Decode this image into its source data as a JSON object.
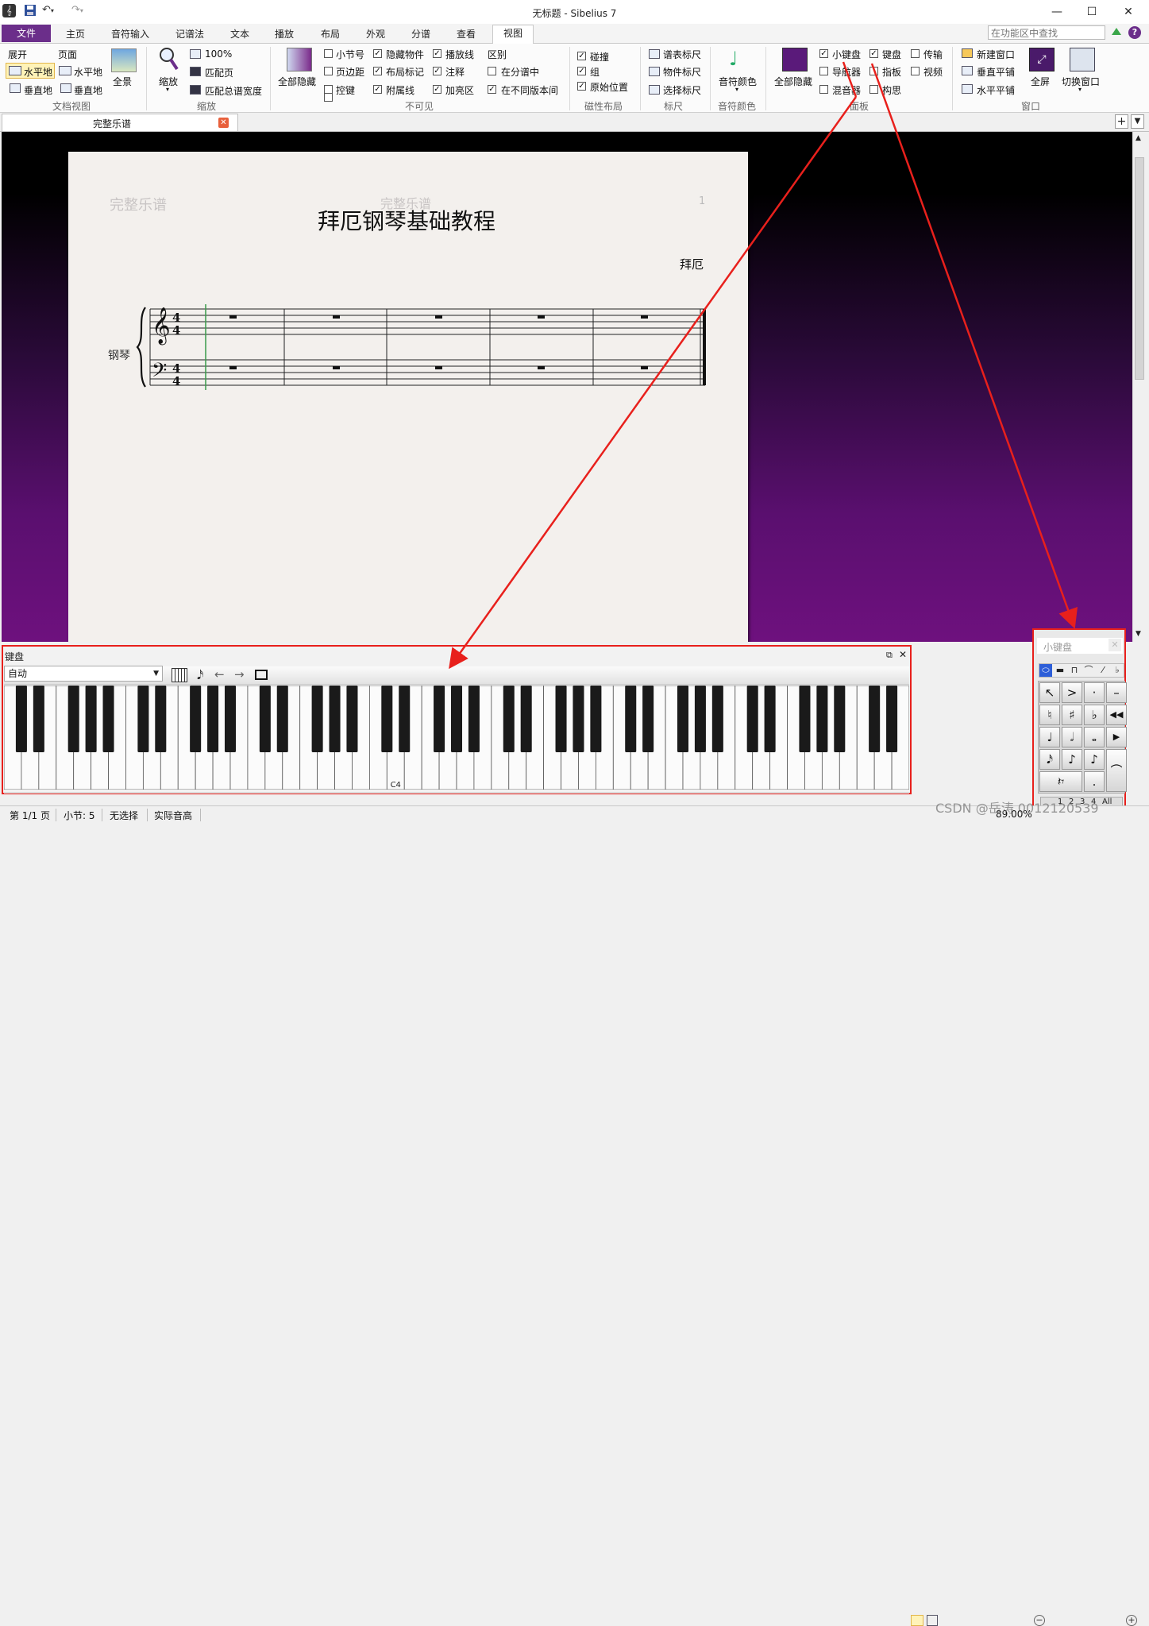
{
  "window": {
    "title": "无标题 - Sibelius 7"
  },
  "tabs": [
    "文件",
    "主页",
    "音符输入",
    "记谱法",
    "文本",
    "播放",
    "布局",
    "外观",
    "分谱",
    "查看",
    "视图"
  ],
  "search_placeholder": "在功能区中查找",
  "ribbon": {
    "docview": {
      "expand": "展开",
      "page": "页面",
      "horizontal": "水平地",
      "horizontal2": "水平地",
      "vertical": "垂直地",
      "vertical2": "垂直地",
      "panorama": "全景",
      "label": "文档视图"
    },
    "zoom": {
      "zoom": "缩放",
      "pct": "100%",
      "fit_page": "匹配页",
      "fit_width": "匹配总谱宽度",
      "label": "缩放"
    },
    "invisibles": {
      "hide_all": "全部隐藏",
      "items": [
        {
          "label": "小节号",
          "checked": false
        },
        {
          "label": "隐藏物件",
          "checked": true
        },
        {
          "label": "播放线",
          "checked": true
        },
        {
          "label": "页边距",
          "checked": false
        },
        {
          "label": "布局标记",
          "checked": true
        },
        {
          "label": "注释",
          "checked": true
        },
        {
          "label": "控键",
          "checked": false
        },
        {
          "label": "附属线",
          "checked": true
        },
        {
          "label": "加亮区",
          "checked": true
        }
      ],
      "diff_title": "区别",
      "diff_items": [
        {
          "label": "在分谱中",
          "checked": false
        },
        {
          "label": "在不同版本间",
          "checked": true
        }
      ],
      "label": "不可见"
    },
    "magnetic": {
      "items": [
        {
          "label": "碰撞",
          "checked": true
        },
        {
          "label": "组",
          "checked": true
        },
        {
          "label": "原始位置",
          "checked": true
        }
      ],
      "label": "磁性布局"
    },
    "rulers": {
      "items": [
        "谱表标尺",
        "物件标尺",
        "选择标尺"
      ],
      "label": "标尺"
    },
    "notecolor": {
      "btn": "音符颜色",
      "label": "音符颜色"
    },
    "panels": {
      "hide_all": "全部隐藏",
      "items": [
        {
          "label": "小键盘",
          "checked": true
        },
        {
          "label": "键盘",
          "checked": true
        },
        {
          "label": "传输",
          "checked": false
        },
        {
          "label": "导航器",
          "checked": false
        },
        {
          "label": "指板",
          "checked": false
        },
        {
          "label": "视频",
          "checked": false
        },
        {
          "label": "混音器",
          "checked": false
        },
        {
          "label": "构思",
          "checked": false
        }
      ],
      "label": "面板"
    },
    "window": {
      "new": "新建窗口",
      "tile_v": "垂直平铺",
      "tile_h": "水平平铺",
      "fullscreen": "全屏",
      "switch": "切换窗口",
      "label": "窗口"
    }
  },
  "doc_tab": "完整乐谱",
  "score": {
    "header_left": "完整乐谱",
    "header_center": "完整乐谱",
    "page_number": "1",
    "title": "拜厄钢琴基础教程",
    "composer": "拜厄",
    "instrument": "钢琴",
    "time_sig": "4/4"
  },
  "keyboard_panel": {
    "title": "键盘",
    "mode": "自动",
    "c4_label": "C4"
  },
  "keypad_panel": {
    "title": "小键盘",
    "bottom": [
      "1",
      "2",
      "3",
      "4",
      "All"
    ]
  },
  "status": {
    "page": "第 1/1 页",
    "bar": "小节: 5",
    "selection": "无选择",
    "pitch": "实际音高",
    "zoom": "89.00%"
  },
  "watermark": "CSDN @岳涛 0012120539",
  "colors": {
    "accent": "#6b2e8a",
    "annotation": "#e8201c"
  }
}
